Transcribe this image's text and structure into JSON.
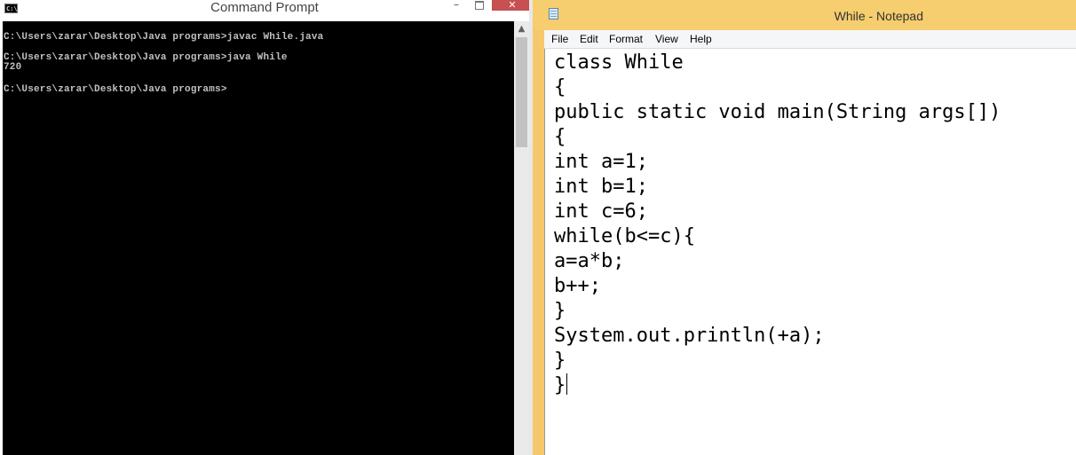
{
  "cmd": {
    "title": "Command Prompt",
    "icon_text": "C:\\",
    "buttons": {
      "minimize": "–",
      "close": "✕"
    },
    "lines": [
      "C:\\Users\\zarar\\Desktop\\Java programs>javac While.java",
      "",
      "C:\\Users\\zarar\\Desktop\\Java programs>java While",
      "720",
      "",
      "C:\\Users\\zarar\\Desktop\\Java programs>"
    ]
  },
  "notepad": {
    "title": "While - Notepad",
    "menu": [
      "File",
      "Edit",
      "Format",
      "View",
      "Help"
    ],
    "code": [
      "class While",
      "{",
      "public static void main(String args[])",
      "{",
      "int a=1;",
      "int b=1;",
      "int c=6;",
      "while(b<=c){",
      "a=a*b;",
      "b++;",
      "}",
      "System.out.println(+a);",
      "}",
      "}"
    ]
  },
  "colors": {
    "console_bg": "#000000",
    "console_text": "#c0c0c0",
    "notepad_frame": "#f5c96b",
    "close_button": "#c75050"
  },
  "icons": {
    "cmd_icon": "command-prompt-icon",
    "notepad_icon": "notepad-icon",
    "scroll_up": "scroll-up-arrow-icon"
  }
}
